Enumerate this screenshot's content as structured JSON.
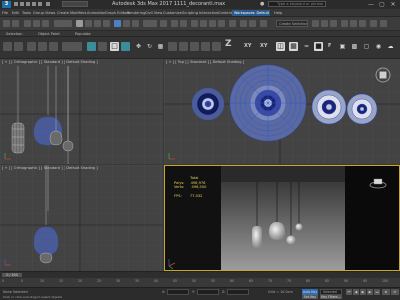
{
  "app": {
    "logo": "3",
    "title": "Autodesk 3ds Max 2017      1111_decoranti.max",
    "search_placeholder": "Type a keyword or phrase"
  },
  "window_buttons": [
    "—",
    "▢",
    "✕"
  ],
  "menu": [
    "File",
    "Edit",
    "Tools",
    "Group",
    "Views",
    "Create",
    "Modifiers",
    "Animation",
    "Graph Editors",
    "Rendering",
    "Civil View",
    "Customize",
    "Scripting",
    "Interactive",
    "Content",
    "Help"
  ],
  "workspace": "Workspaces: Default",
  "toolbar": {
    "selection_set": "Create Selection Se"
  },
  "ribbon_tabs": [
    "Selection",
    "Object Paint",
    "Populate"
  ],
  "modeling_bar": {
    "icons": [
      "undo-icon",
      "redo-icon",
      "link-icon",
      "unlink-icon",
      "bind-icon",
      "selection-filter-icon",
      "select-icon",
      "select-by-name-icon",
      "rect-region-icon",
      "window-crossing-icon",
      "move-icon",
      "rotate-icon",
      "scale-icon"
    ],
    "letters": [
      "Z",
      "XY",
      "XY",
      "F"
    ]
  },
  "viewports": {
    "top": "[ + ] [ Orthographic ] [ Standard ] [ Default Shading ]",
    "front": "[ + ] [ Top ] [ Standard ] [ Default Shading ]",
    "left": "[ + ] [ Orthographic ] [ Standard ] [ Default Shading ]",
    "perspective": "[ + ] [ Perspective ] [ Standard ] [ Default Shading ]",
    "stats": {
      "header": "Total",
      "polys_label": "Polys:",
      "polys_value": "496,976",
      "verts_label": "Verts:",
      "verts_value": "496,500",
      "fps_label": "FPS:",
      "fps_value": "77.032"
    }
  },
  "timeline": {
    "frame": "0 / 100",
    "ticks": [
      "0",
      "5",
      "10",
      "15",
      "20",
      "25",
      "30",
      "35",
      "40",
      "45",
      "50",
      "55",
      "60",
      "65",
      "70",
      "75",
      "80",
      "85",
      "90",
      "95",
      "100"
    ]
  },
  "status": {
    "left": "None Selected",
    "hint": "Click or click-and-drag to select objects",
    "x_label": "X:",
    "y_label": "Y:",
    "z_label": "Z:",
    "grid": "Grid = 10.0cm",
    "auto_key": "Auto Key",
    "selected": "Selected",
    "set_key": "Set Key",
    "key_filters": "Key Filters..."
  },
  "colors": {
    "wire_blue": "#2f52d6",
    "selection_yellow": "#c9a72c"
  }
}
